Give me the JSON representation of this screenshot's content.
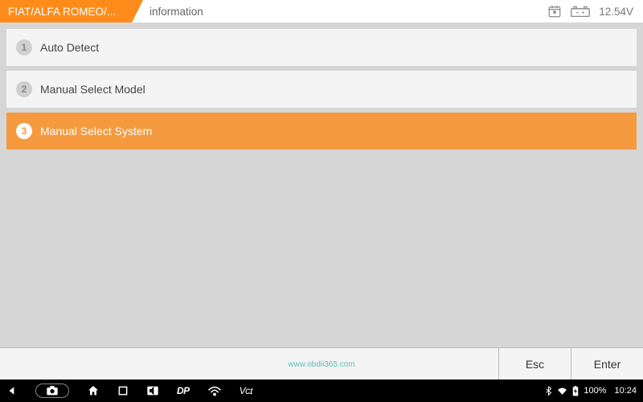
{
  "header": {
    "brand_label": "FIAT/ALFA ROMEO/...",
    "info_label": "information",
    "battery_voltage": "12.54V"
  },
  "menu": {
    "items": [
      {
        "num": "1",
        "label": "Auto Detect",
        "selected": false
      },
      {
        "num": "2",
        "label": "Manual Select Model",
        "selected": false
      },
      {
        "num": "3",
        "label": "Manual Select System",
        "selected": true
      }
    ]
  },
  "footer": {
    "esc_label": "Esc",
    "enter_label": "Enter"
  },
  "sysbar": {
    "dp": "DP",
    "vci": "Vᴄɪ",
    "battery_pct": "100%",
    "time": "10:24"
  },
  "watermark": "www.obdii365.com"
}
